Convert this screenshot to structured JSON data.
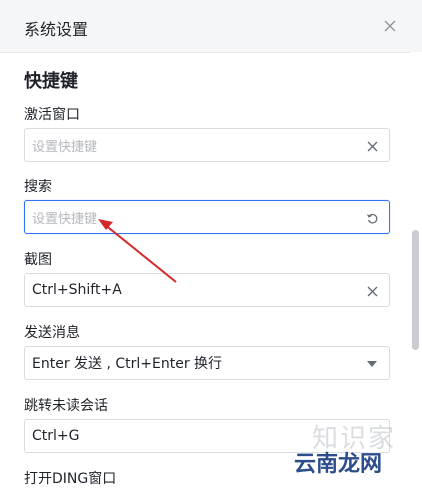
{
  "window": {
    "title": "系统设置"
  },
  "section": {
    "title": "快捷键"
  },
  "fields": [
    {
      "label": "激活窗口",
      "value": "",
      "placeholder": "设置快捷键",
      "icon": "clear-icon"
    },
    {
      "label": "搜索",
      "value": "",
      "placeholder": "设置快捷键",
      "icon": "reset-icon"
    },
    {
      "label": "截图",
      "value": "Ctrl+Shift+A",
      "placeholder": "",
      "icon": "clear-icon"
    },
    {
      "label": "发送消息",
      "value": "Enter 发送 , Ctrl+Enter 换行",
      "placeholder": "",
      "icon": "dropdown-caret-icon"
    },
    {
      "label": "跳转未读会话",
      "value": "Ctrl+G",
      "placeholder": "",
      "icon": ""
    },
    {
      "label": "打开DING窗口",
      "value": "",
      "placeholder": "",
      "icon": ""
    }
  ],
  "watermark": {
    "top": "知识家",
    "bottom": "云南龙网"
  },
  "colors": {
    "annotation_arrow": "#d12a2a",
    "focus_border": "#3370ff"
  }
}
